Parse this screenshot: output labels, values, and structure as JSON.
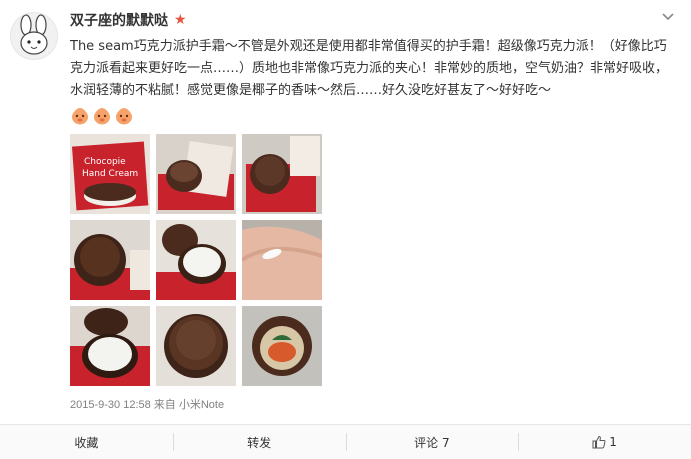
{
  "post": {
    "username": "双子座的默默哒",
    "text": "The seam巧克力派护手霜～不管是外观还是使用都非常值得买的护手霜！超级像巧克力派！（好像比巧克力派看起来更好吃一点……）质地也非常像巧克力派的夹心！非常妙的质地，空气奶油？非常好吸收，水润轻薄的不粘腻！感觉更像是椰子的香味～然后……好久没吃好甚友了～好好吃～",
    "timestamp": "2015-9-30 12:58",
    "source_prefix": "来自",
    "source": "小米Note",
    "images": [
      {
        "icon": "photo-package-front"
      },
      {
        "icon": "photo-package-open"
      },
      {
        "icon": "photo-cream-tin-in-wrapper"
      },
      {
        "icon": "photo-tin-closed"
      },
      {
        "icon": "photo-tin-open-white-cream"
      },
      {
        "icon": "photo-cream-on-hand"
      },
      {
        "icon": "photo-tin-open-angle"
      },
      {
        "icon": "photo-tin-closed-on-paper"
      },
      {
        "icon": "photo-tin-with-illustration"
      }
    ],
    "packaging_text": [
      "Chocopie",
      "Hand Cream"
    ]
  },
  "actions": {
    "favorite": "收藏",
    "repost": "转发",
    "comment": "评论 7",
    "like_count": "1"
  },
  "colors": {
    "accent_star": "#e8543c",
    "meta_gray": "#808080",
    "action_bar_bg": "#fafafa",
    "chocolate": "#4a2b1e",
    "wrapper_red": "#c8222c"
  }
}
